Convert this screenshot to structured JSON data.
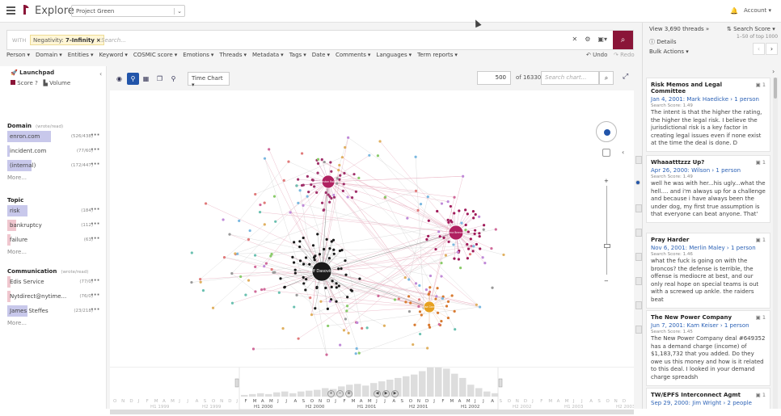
{
  "app": {
    "title": "Explore",
    "project": "Project Green",
    "account": "Account"
  },
  "search": {
    "with_label": "WITH",
    "chip_facet": "Negativity:",
    "chip_value": "7-Infinity",
    "chip_close": "×",
    "placeholder": "Search..."
  },
  "menus": [
    "Person",
    "Domain",
    "Entities",
    "Keyword",
    "COSMIC score",
    "Emotions",
    "Threads",
    "Metadata",
    "Tags",
    "Date",
    "Comments",
    "Languages",
    "Term reports"
  ],
  "history": {
    "undo": "Undo",
    "redo": "Redo"
  },
  "left": {
    "title": "Launchpad",
    "toggle_score": "Score",
    "toggle_volume": "Volume",
    "sections": [
      {
        "title": "Domain",
        "sub": "(wrote/read)",
        "items": [
          {
            "name": "enron.com",
            "count": "(526/438)",
            "fill": 0.82,
            "color": "#c8c8eb"
          },
          {
            "name": "incident.com",
            "count": "(77/60)",
            "fill": 0.05,
            "color": "#c8c8eb"
          },
          {
            "name": "(internal)",
            "count": "(172/447)",
            "fill": 0.45,
            "color": "#c8c8eb"
          }
        ],
        "more": "More..."
      },
      {
        "title": "Topic",
        "sub": "",
        "items": [
          {
            "name": "risk",
            "count": "(184)",
            "fill": 0.38,
            "color": "#c8c8eb"
          },
          {
            "name": "bankruptcy",
            "count": "(112)",
            "fill": 0.16,
            "color": "#f0c7cf"
          },
          {
            "name": "failure",
            "count": "(63)",
            "fill": 0.06,
            "color": "#f0c7cf"
          }
        ],
        "more": "More..."
      },
      {
        "title": "Communication",
        "sub": "(wrote/read)",
        "items": [
          {
            "name": "Edis Service",
            "count": "(77/0)",
            "fill": 0.06,
            "color": "#f0c7cf"
          },
          {
            "name": "Nytdirect@nytime...",
            "count": "(76/0)",
            "fill": 0.06,
            "color": "#f0c7cf"
          },
          {
            "name": "James Steffes",
            "count": "(23/218)",
            "fill": 0.38,
            "color": "#c8c8eb"
          }
        ],
        "more": "More..."
      }
    ]
  },
  "chart_toolbar": {
    "view_select": "Time Chart",
    "count_input": "500",
    "of_total": "of 16330",
    "search_placeholder": "Search chart..."
  },
  "graph_nodes": [
    {
      "label": "Jeff Dasovich",
      "color": "#1a1a1a"
    },
    {
      "label": "Johnston Robert",
      "color": "#b02060"
    },
    {
      "label": "Lorna Brennan",
      "color": "#b02060"
    },
    {
      "label": "Lisa Gang",
      "color": "#e6a020"
    }
  ],
  "timeline": {
    "months": [
      "O",
      "N",
      "D",
      "J",
      "F",
      "M",
      "A",
      "M",
      "J",
      "J",
      "A",
      "S",
      "O",
      "N",
      "D",
      "J",
      "F",
      "M",
      "A",
      "M",
      "J",
      "J",
      "A",
      "S",
      "O",
      "N",
      "D",
      "J",
      "F",
      "M",
      "A",
      "M",
      "J",
      "J",
      "A",
      "S",
      "O",
      "N",
      "D",
      "J",
      "F",
      "M",
      "A",
      "M",
      "J",
      "J",
      "A",
      "S",
      "O",
      "N",
      "D",
      "J",
      "F",
      "M",
      "A",
      "M",
      "J",
      "J",
      "A",
      "S",
      "O",
      "N",
      "D"
    ],
    "halves": [
      "H1 1999",
      "H2 1999",
      "H1 2000",
      "H2 2000",
      "H1 2001",
      "H2 2001",
      "H1 2002",
      "H2 2002",
      "H1 2003",
      "H2 2003"
    ],
    "bars": [
      2,
      3,
      4,
      3,
      5,
      6,
      4,
      6,
      7,
      8,
      10,
      9,
      12,
      14,
      15,
      13,
      16,
      18,
      20,
      22,
      24,
      26,
      30,
      35,
      40,
      33,
      27,
      22,
      14,
      10,
      6,
      4
    ]
  },
  "right": {
    "view_threads": "View 3,690 threads »",
    "sort": "Search Score",
    "range": "1–50 of top 1000",
    "details": "Details",
    "bulk": "Bulk Actions",
    "cards": [
      {
        "title": "Risk Memos and Legal Committee",
        "count": "1",
        "date": "Jan 4, 2001:",
        "from": "Mark Haedicke",
        "to": "1 person",
        "score": "Search Score: 1.49",
        "body": "The intent is that the higher the rating, the higher the legal risk. I believe the jurisdictional risk is a key factor in creating legal issues even if none exist at the time the deal is done. D"
      },
      {
        "title": "Whaaatttzzz Up?",
        "count": "1",
        "date": "Apr 26, 2000:",
        "from": "Wilson",
        "to": "1 person",
        "score": "Search Score: 1.49",
        "body": "well he was with her...his ugly...what the hell.... and i'm always up for a challenge and because i have always been the under dog, my first true assumption is that everyone can beat anyone. That'"
      },
      {
        "title": "Pray Harder",
        "count": "1",
        "date": "Nov 6, 2001:",
        "from": "Merlin Maley",
        "to": "1 person",
        "score": "Search Score: 1.46",
        "body": "what the fuck is going on with the broncos? the defense is terrible, the offense is mediocre at best, and our only real hope on special teams is out with a screwed up ankle. the raiders beat"
      },
      {
        "title": "The New Power Company",
        "count": "1",
        "date": "Jun 7, 2001:",
        "from": "Kam Keiser",
        "to": "1 person",
        "score": "Search Score: 1.45",
        "body": "The New Power Company deal #649352 has a demand charge (income) of $1,183,732 that you added. Do they owe us this money and how is it related to this deal. I looked in your demand charge spreadsh"
      },
      {
        "title": "TW/EPFS Interconnect Agmt",
        "count": "1",
        "date": "Sep 29, 2000:",
        "from": "Jim Wright",
        "to": "2 people",
        "score": "",
        "body": ""
      }
    ]
  }
}
